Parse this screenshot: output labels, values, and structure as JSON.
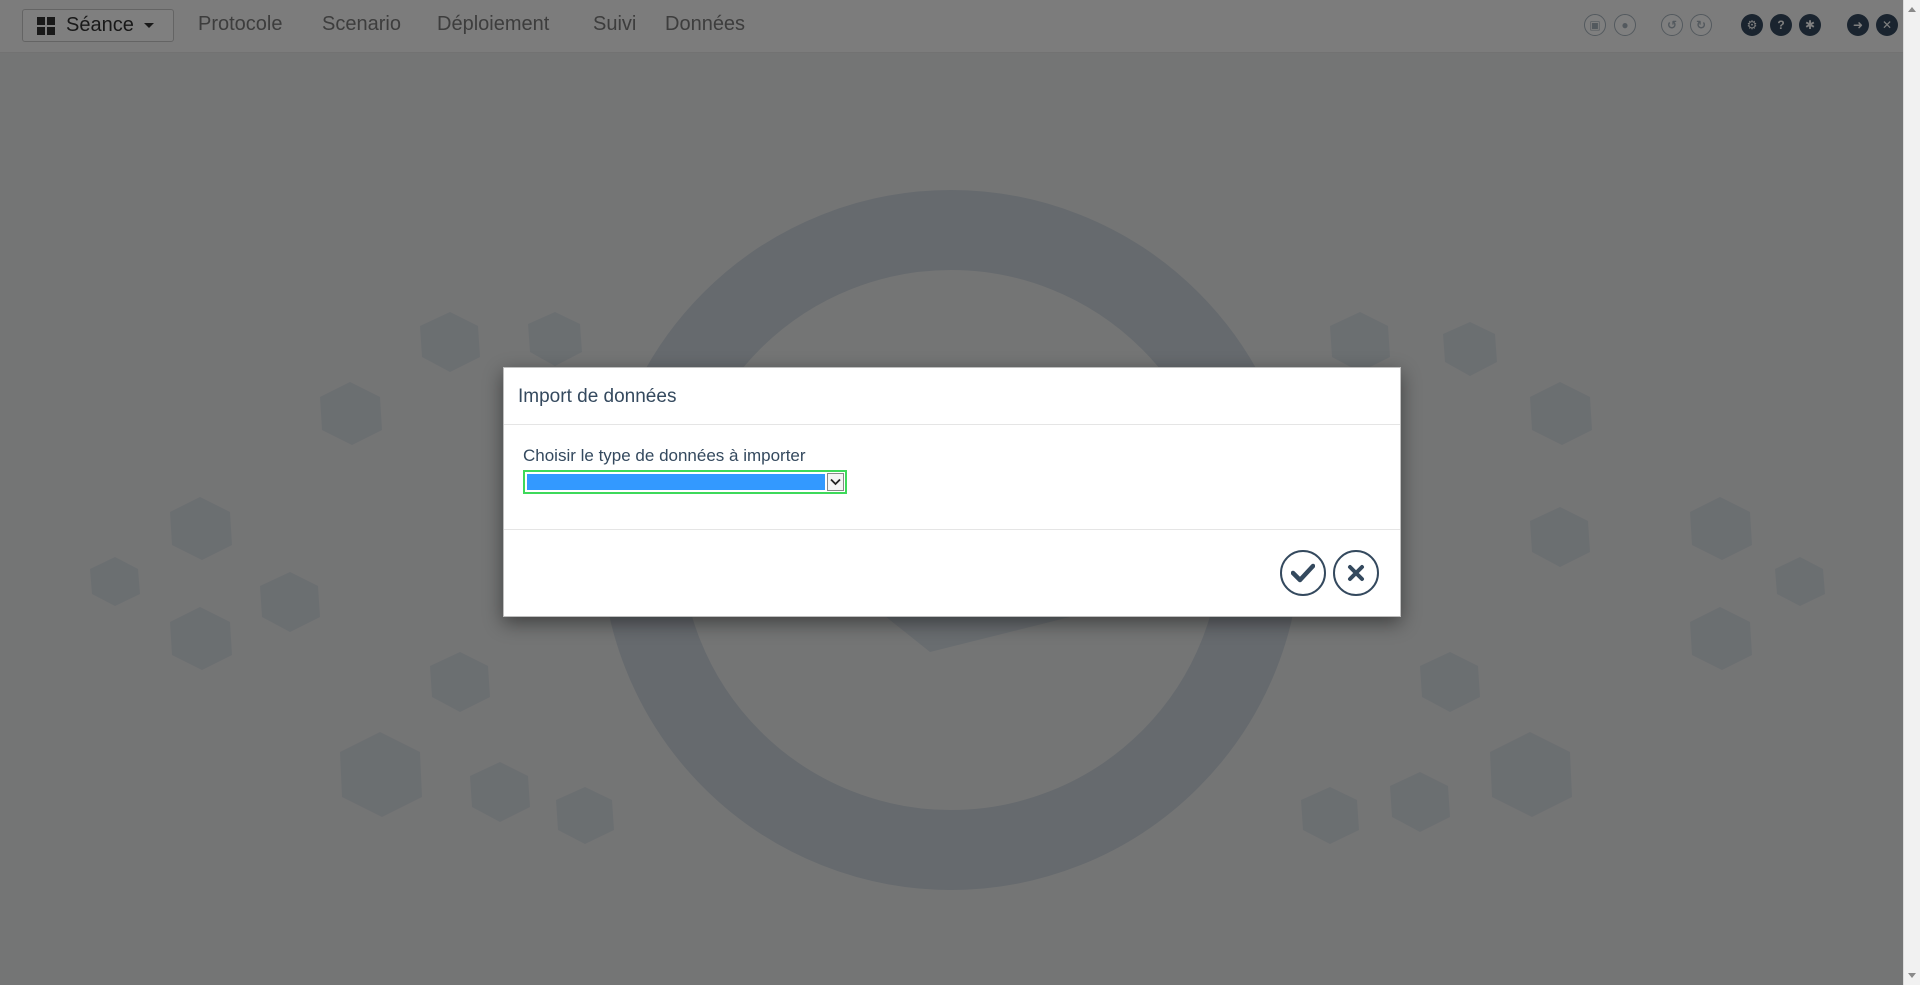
{
  "navbar": {
    "session_label": "Séance",
    "items": [
      {
        "label": "Protocole"
      },
      {
        "label": "Scenario"
      },
      {
        "label": "Déploiement"
      },
      {
        "label": "Suivi"
      },
      {
        "label": "Données"
      }
    ],
    "tools": [
      {
        "icon": "save-icon"
      },
      {
        "icon": "unlock-icon"
      },
      {
        "icon": "undo-icon"
      },
      {
        "icon": "redo-icon"
      },
      {
        "icon": "settings-icon"
      },
      {
        "icon": "help-icon"
      },
      {
        "icon": "bug-icon"
      },
      {
        "icon": "logout-icon"
      },
      {
        "icon": "close-window-icon"
      }
    ]
  },
  "modal": {
    "title": "Import de données",
    "field_label": "Choisir le type de données à importer",
    "select_value": "",
    "confirm_icon": "check-icon",
    "cancel_icon": "close-icon"
  },
  "colors": {
    "primary": "#34495e",
    "select_highlight": "#3399ff",
    "focus_border": "#3ed95a"
  }
}
